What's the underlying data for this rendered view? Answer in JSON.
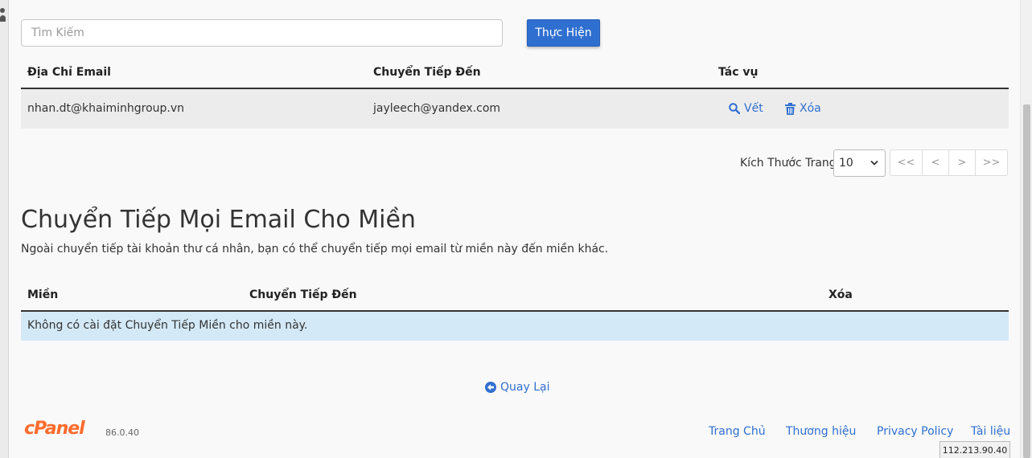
{
  "search": {
    "placeholder": "Tìm Kiếm",
    "submit_label": "Thực Hiện"
  },
  "forwarders_table": {
    "headers": [
      "Địa Chỉ Email",
      "Chuyển Tiếp Đến",
      "Tác vụ"
    ],
    "rows": [
      {
        "address": "nhan.dt@khaiminhgroup.vn",
        "forward_to": "jayleech@yandex.com",
        "edit_label": "Vết",
        "delete_label": "Xóa"
      }
    ]
  },
  "pagination": {
    "page_size_label": "Kích Thước Trang",
    "page_size_value": "10",
    "buttons": [
      "<<",
      "<",
      ">",
      ">>"
    ]
  },
  "domain_forwarders": {
    "title": "Chuyển Tiếp Mọi Email Cho Miền",
    "description": "Ngoài chuyển tiếp tài khoản thư cá nhân, bạn có thể chuyển tiếp mọi email từ miền này đến miền khác.",
    "headers": [
      "Miền",
      "Chuyển Tiếp Đến",
      "Xóa"
    ],
    "empty_message": "Không có cài đặt Chuyển Tiếp Miền cho miền này."
  },
  "back_link": {
    "label": "Quay Lại"
  },
  "footer": {
    "logo_text": "cPanel",
    "version": "86.0.40",
    "links": [
      "Trang Chủ",
      "Thương hiệu",
      "Privacy Policy",
      "Tài liệu"
    ],
    "ip_address": "112.213.90.40"
  },
  "colors": {
    "primary": "#2f6fd0",
    "empty_row": "#d4e9f7",
    "brand": "#ff6c2c"
  }
}
